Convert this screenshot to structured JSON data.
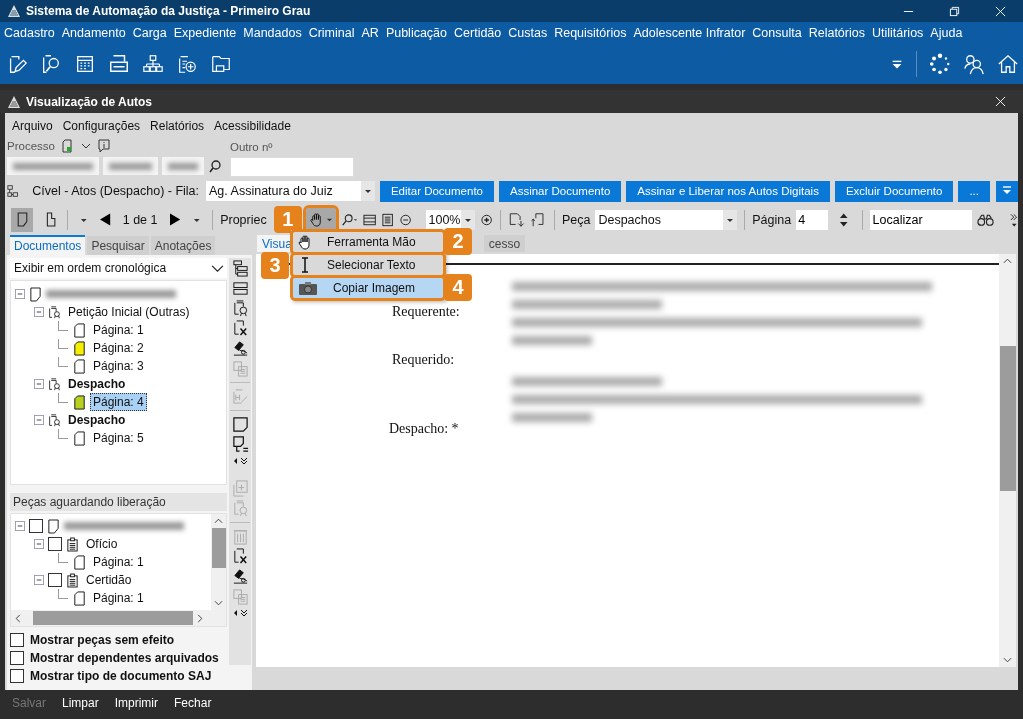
{
  "window": {
    "title": "Sistema de Automação da Justiça - Primeiro Grau"
  },
  "main_menu": [
    "Cadastro",
    "Andamento",
    "Carga",
    "Expediente",
    "Mandados",
    "Criminal",
    "AR",
    "Publicação",
    "Certidão",
    "Custas",
    "Requisitórios",
    "Adolescente Infrator",
    "Consulta",
    "Relatórios",
    "Utilitários",
    "Ajuda"
  ],
  "child_window": {
    "title": "Visualização de Autos"
  },
  "child_menu": [
    "Arquivo",
    "Configurações",
    "Relatórios",
    "Acessibilidade"
  ],
  "process": {
    "label": "Processo",
    "other_label": "Outro nº"
  },
  "workflow": {
    "label": "Cível - Atos (Despacho) - Fila:",
    "queue": "Ag. Assinatura do Juiz"
  },
  "actions": [
    "Editar Documento",
    "Assinar Documento",
    "Assinar e Liberar nos Autos Digitais",
    "Excluir Documento",
    "..."
  ],
  "toolbar": {
    "pager": "1 de 1",
    "properties": "Propriec",
    "hand_pressed": true,
    "hand_callout": "1",
    "zoom": "100%",
    "piece_label": "Peça",
    "piece": "Despachos",
    "page_label": "Página",
    "page": "4",
    "search": "Localizar"
  },
  "hand_menu": [
    {
      "kind": "hand",
      "label": "Ferramenta Mão",
      "selected": false,
      "callout": "2"
    },
    {
      "kind": "cursor",
      "label": "Selecionar Texto",
      "selected": false,
      "callout": "3"
    },
    {
      "kind": "camera",
      "label": "Copiar Imagem",
      "selected": true,
      "callout": "4"
    }
  ],
  "left_tabs": [
    {
      "label": "Documentos",
      "selected": true
    },
    {
      "label": "Pesquisar",
      "selected": false
    },
    {
      "label": "Anotações",
      "selected": false
    }
  ],
  "order": "Exibir em ordem cronológica",
  "tree": [
    {
      "kind": "process",
      "expanded": true,
      "children": [
        {
          "kind": "document",
          "label": "Petição Inicial (Outras)",
          "highlighted": false,
          "expanded": true,
          "selected": false,
          "children": [
            {
              "kind": "page",
              "label": "Página: 1",
              "selected": false
            },
            {
              "kind": "page",
              "label": "Página: 2",
              "color": "#f4f000",
              "selected": false
            },
            {
              "kind": "page",
              "label": "Página: 3",
              "selected": false
            }
          ]
        },
        {
          "kind": "document",
          "label": "Despacho",
          "highlighted": true,
          "expanded": true,
          "selected": false,
          "children": [
            {
              "kind": "page",
              "label": "Página: 4",
              "color": "#b8d020",
              "selected": true
            }
          ]
        },
        {
          "kind": "document",
          "label": "Despacho",
          "highlighted": true,
          "expanded": true,
          "selected": false,
          "children": [
            {
              "kind": "page",
              "label": "Página: 5",
              "selected": false
            }
          ]
        }
      ]
    }
  ],
  "side_tools": [
    {
      "kind": "tree",
      "disabled": false
    },
    {
      "kind": "layout",
      "disabled": false
    },
    {
      "kind": "certificate",
      "disabled": false
    },
    {
      "kind": "remove",
      "disabled": false
    },
    {
      "kind": "judge",
      "disabled": false
    },
    {
      "kind": "copy",
      "disabled": true
    },
    {
      "kind": "separator"
    },
    {
      "kind": "edit",
      "disabled": true
    },
    {
      "kind": "separator"
    },
    {
      "kind": "note",
      "disabled": false
    },
    {
      "kind": "note-list",
      "disabled": false
    },
    {
      "kind": "more",
      "disabled": false
    },
    {
      "kind": "gap"
    },
    {
      "kind": "copy-in",
      "disabled": true
    },
    {
      "kind": "certificate",
      "disabled": true
    },
    {
      "kind": "separator"
    },
    {
      "kind": "trash",
      "disabled": true
    },
    {
      "kind": "remove",
      "disabled": false
    },
    {
      "kind": "judge",
      "disabled": false
    },
    {
      "kind": "copy",
      "disabled": true
    },
    {
      "kind": "more",
      "disabled": false
    }
  ],
  "pending": {
    "title": "Peças aguardando liberação",
    "tree": [
      {
        "kind": "process",
        "expanded": true,
        "checked": false,
        "children": [
          {
            "kind": "office",
            "label": "Ofício",
            "expanded": true,
            "checked": false,
            "children": [
              {
                "kind": "page",
                "label": "Página: 1"
              }
            ]
          },
          {
            "kind": "office",
            "label": "Certidão",
            "expanded": true,
            "checked": false,
            "children": [
              {
                "kind": "page",
                "label": "Página: 1"
              }
            ]
          }
        ]
      }
    ]
  },
  "options": [
    {
      "label": "Mostrar peças sem efeito",
      "checked": false
    },
    {
      "label": "Mostrar dependentes arquivados",
      "checked": false
    },
    {
      "label": "Mostrar tipo de documento SAJ",
      "checked": false
    }
  ],
  "doc_tabs": [
    {
      "label": "Visua",
      "selected": true
    },
    {
      "label": "cesso",
      "selected": false
    }
  ],
  "document": {
    "fields": [
      "Requerente:",
      "Requerido:",
      "Despacho: *"
    ]
  },
  "footer": [
    {
      "label": "Salvar",
      "disabled": true
    },
    {
      "label": "Limpar",
      "disabled": false
    },
    {
      "label": "Imprimir",
      "disabled": false
    },
    {
      "label": "Fechar",
      "disabled": false
    }
  ]
}
